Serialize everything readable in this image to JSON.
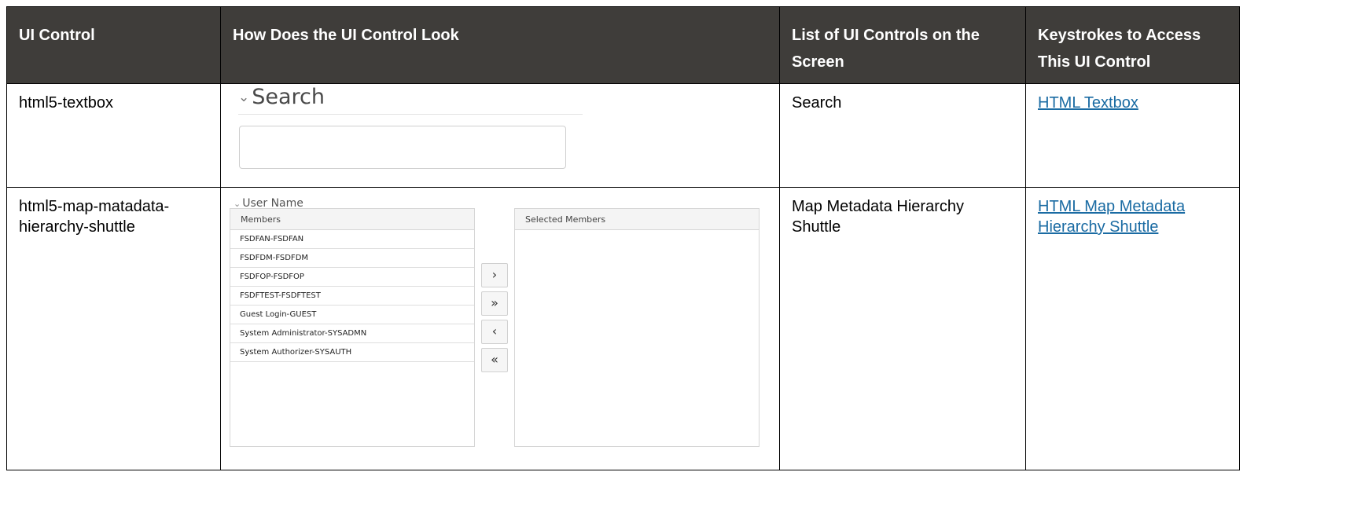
{
  "table": {
    "headers": [
      "UI Control",
      "How Does the UI Control Look",
      "List of UI Controls on the Screen",
      "Keystrokes to Access This UI Control"
    ],
    "rows": [
      {
        "control": "html5-textbox",
        "list": "Search",
        "link": "HTML Textbox",
        "preview": {
          "title": "Search",
          "title_icon": "chevron-down-icon"
        }
      },
      {
        "control": "html5-map-matadata-hierarchy-shuttle",
        "list": "Map Metadata Hierarchy Shuttle",
        "link": "HTML Map Metadata Hierarchy Shuttle",
        "preview": {
          "title": "User Name",
          "title_icon": "chevron-down-icon",
          "left_header": "Members",
          "right_header": "Selected Members",
          "members": [
            "FSDFAN-FSDFAN",
            "FSDFDM-FSDFDM",
            "FSDFOP-FSDFOP",
            "FSDFTEST-FSDFTEST",
            "Guest Login-GUEST",
            "System Administrator-SYSADMN",
            "System Authorizer-SYSAUTH"
          ],
          "buttons": [
            "›",
            "»",
            "‹",
            "«"
          ]
        }
      }
    ]
  },
  "colors": {
    "header_bg": "#3f3d3a",
    "header_text": "#ffffff",
    "link": "#1a6ba3"
  }
}
